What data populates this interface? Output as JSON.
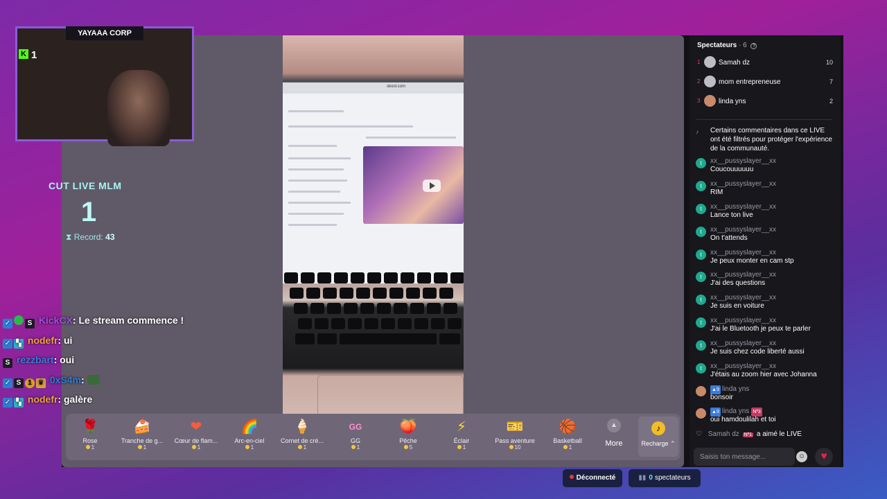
{
  "webcam": {
    "title": "YAYAAA CORP",
    "kick_count": "1"
  },
  "counter": {
    "title": "CUT LIVE MLM",
    "value": "1",
    "record_label": "Record:",
    "record_value": "43"
  },
  "overlay_chat": [
    {
      "user": "KickCX",
      "user_color": "#a04fe0",
      "text": ": Le stream commence !"
    },
    {
      "user": "nodefr",
      "user_color": "#f0a040",
      "text": ": ui"
    },
    {
      "user": "rezzbart",
      "user_color": "#3b7be0",
      "text": ": oui"
    },
    {
      "user": "0xS4m",
      "user_color": "#2a7fd4",
      "text": ":"
    },
    {
      "user": "nodefr",
      "user_color": "#f0a040",
      "text": ": galère"
    }
  ],
  "video": {
    "url": "skool.com"
  },
  "gifts": [
    {
      "icon": "🌹",
      "name": "Rose",
      "price": "1"
    },
    {
      "icon": "🍰",
      "name": "Tranche de g...",
      "price": "1"
    },
    {
      "icon": "❤",
      "name": "Cœur de flam...",
      "price": "1"
    },
    {
      "icon": "🌈",
      "name": "Arc-en-ciel",
      "price": "1"
    },
    {
      "icon": "🍦",
      "name": "Cornet de crè...",
      "price": "1"
    },
    {
      "icon": "GG",
      "name": "GG",
      "price": "1"
    },
    {
      "icon": "🍑",
      "name": "Pêche",
      "price": "5"
    },
    {
      "icon": "⚡",
      "name": "Éclair",
      "price": "1"
    },
    {
      "icon": "🎫",
      "name": "Pass aventure",
      "price": "10"
    },
    {
      "icon": "🏀",
      "name": "Basketball",
      "price": "1"
    }
  ],
  "more_label": "More",
  "recharge_label": "Recharge",
  "spectators": {
    "title": "Spectateurs",
    "count": "· 6",
    "top": [
      {
        "rank": "1",
        "name": "Samah dz",
        "score": "10"
      },
      {
        "rank": "2",
        "name": "mom entrepreneuse",
        "score": "7"
      },
      {
        "rank": "3",
        "name": "linda yns",
        "score": "2"
      }
    ]
  },
  "chat": {
    "notice": "Certains commentaires dans ce LIVE ont été filtrés pour protéger l'expérience de la communauté.",
    "messages": [
      {
        "user": "xx__pussyslayer__xx",
        "text": "Coucouuuuuu"
      },
      {
        "user": "xx__pussyslayer__xx",
        "text": "RIM"
      },
      {
        "user": "xx__pussyslayer__xx",
        "text": "Lance ton live"
      },
      {
        "user": "xx__pussyslayer__xx",
        "text": "On t'attends"
      },
      {
        "user": "xx__pussyslayer__xx",
        "text": "Je peux monter en cam stp"
      },
      {
        "user": "xx__pussyslayer__xx",
        "text": "J'ai des questions"
      },
      {
        "user": "xx__pussyslayer__xx",
        "text": "Je suis en voiture"
      },
      {
        "user": "xx__pussyslayer__xx",
        "text": "J'ai le Bluetooth je peux te parler"
      },
      {
        "user": "xx__pussyslayer__xx",
        "text": "Je suis chez code liberté aussi"
      },
      {
        "user": "xx__pussyslayer__xx",
        "text": "J'étais au zoom hier avec Johanna"
      }
    ],
    "linda_messages": [
      {
        "level": "9",
        "user": "linda yns",
        "rank": "",
        "text": "bonsoir"
      },
      {
        "level": "9",
        "user": "linda yns",
        "rank": "Nº3",
        "text": "oui hamdoulilah et toi"
      }
    ],
    "liked": {
      "user": "Samah dz",
      "rank": "Nº1",
      "text": "a aimé le LIVE"
    },
    "input_placeholder": "Saisis ton message..."
  },
  "status": {
    "connection": "Déconnecté",
    "viewers_count": "0",
    "viewers_label": "spectateurs"
  }
}
